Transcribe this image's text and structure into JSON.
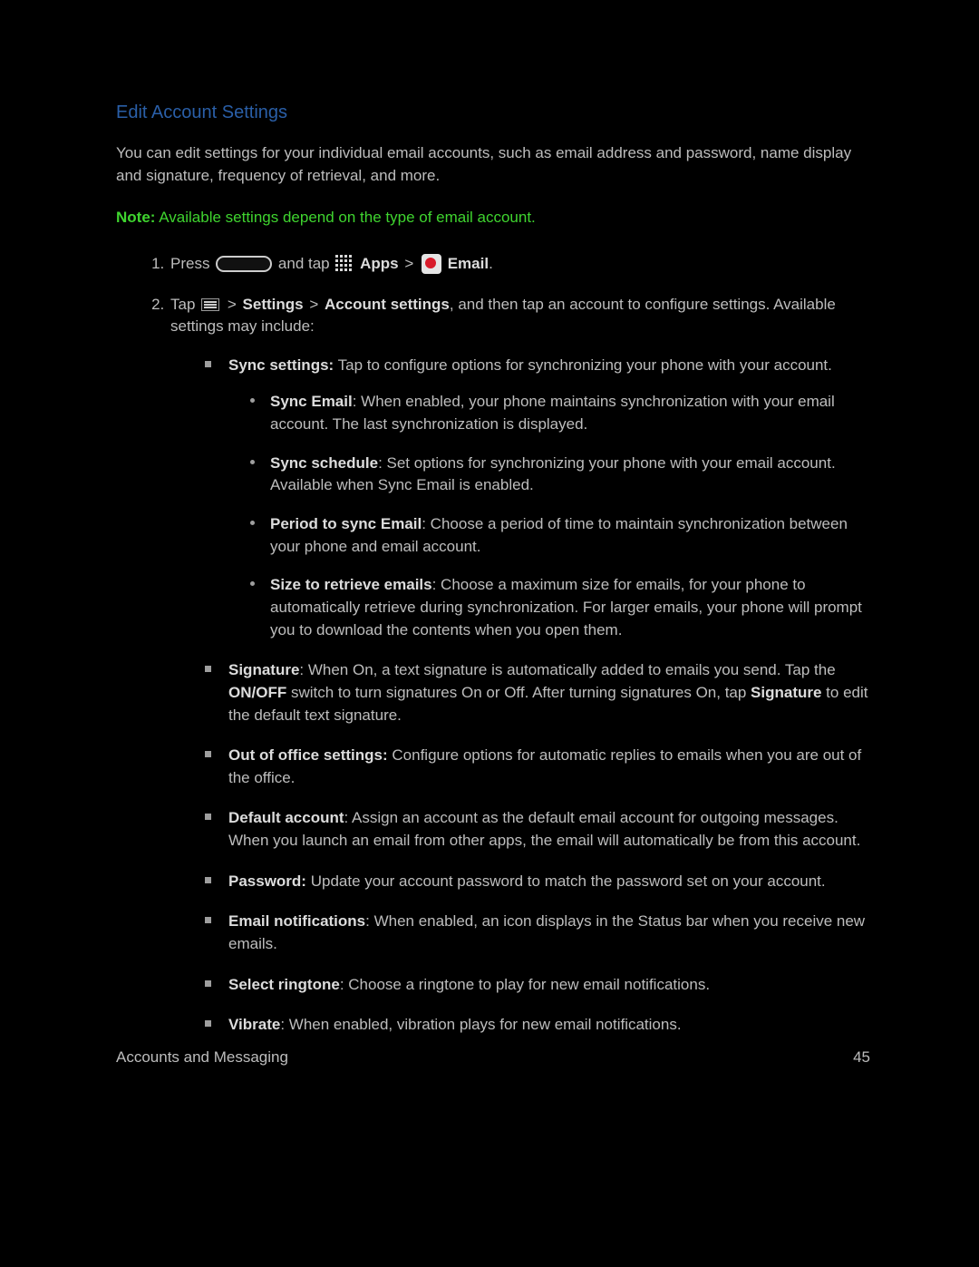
{
  "title": "Edit Account Settings",
  "intro": "You can edit settings for your individual email accounts, such as email address and password, name display and signature, frequency of retrieval, and more.",
  "note_label": "Note:",
  "note_text": " Available settings depend on the type of email account.",
  "step1": {
    "press": "Press ",
    "and_tap": " and tap ",
    "apps": " Apps",
    "gt1": " > ",
    "email": " Email",
    "period": "."
  },
  "step2": {
    "tap": "Tap ",
    "gt1": " > ",
    "settings": "Settings",
    "gt2": " > ",
    "account_settings": "Account settings",
    "rest": ", and then tap an account to configure settings. Available settings may include:"
  },
  "sync_settings": {
    "label": "Sync settings:",
    "text": " Tap to configure options for synchronizing your phone with your account."
  },
  "sync_email": {
    "label": "Sync Email",
    "text": ": When enabled, your phone maintains synchronization with your email account. The last synchronization is displayed."
  },
  "sync_schedule": {
    "label": "Sync schedule",
    "text": ": Set options for synchronizing your phone with your email account. Available when Sync Email is enabled."
  },
  "period": {
    "label": "Period to sync Email",
    "text": ": Choose a period of time to maintain synchronization between your phone and email account."
  },
  "size": {
    "label": "Size to retrieve emails",
    "text": ": Choose a maximum size for emails, for your phone to automatically retrieve during synchronization. For larger emails, your phone will prompt you to download the contents when you open them."
  },
  "signature": {
    "label": "Signature",
    "t1": ": When On, a text signature is automatically added to emails you send. Tap the ",
    "onoff": "ON/OFF",
    "t2": " switch to turn signatures On or Off. After turning signatures On, tap ",
    "sig2": "Signature",
    "t3": " to edit the default text signature."
  },
  "ooo": {
    "label": "Out of office settings:",
    "text": " Configure options for automatic replies to emails when you are out of the office."
  },
  "default_acct": {
    "label": "Default account",
    "text": ": Assign an account as the default email account for outgoing messages. When you launch an email from other apps, the email will automatically be from this account."
  },
  "password": {
    "label": "Password:",
    "text": " Update your account password to match the password set on your account."
  },
  "email_notif": {
    "label": "Email notifications",
    "text": ": When enabled, an icon displays in the Status bar when you receive new emails."
  },
  "ringtone": {
    "label": "Select ringtone",
    "text": ": Choose a ringtone to play for new email notifications."
  },
  "vibrate": {
    "label": "Vibrate",
    "text": ": When enabled, vibration plays for new email notifications."
  },
  "footer_left": "Accounts and Messaging",
  "footer_right": "45"
}
